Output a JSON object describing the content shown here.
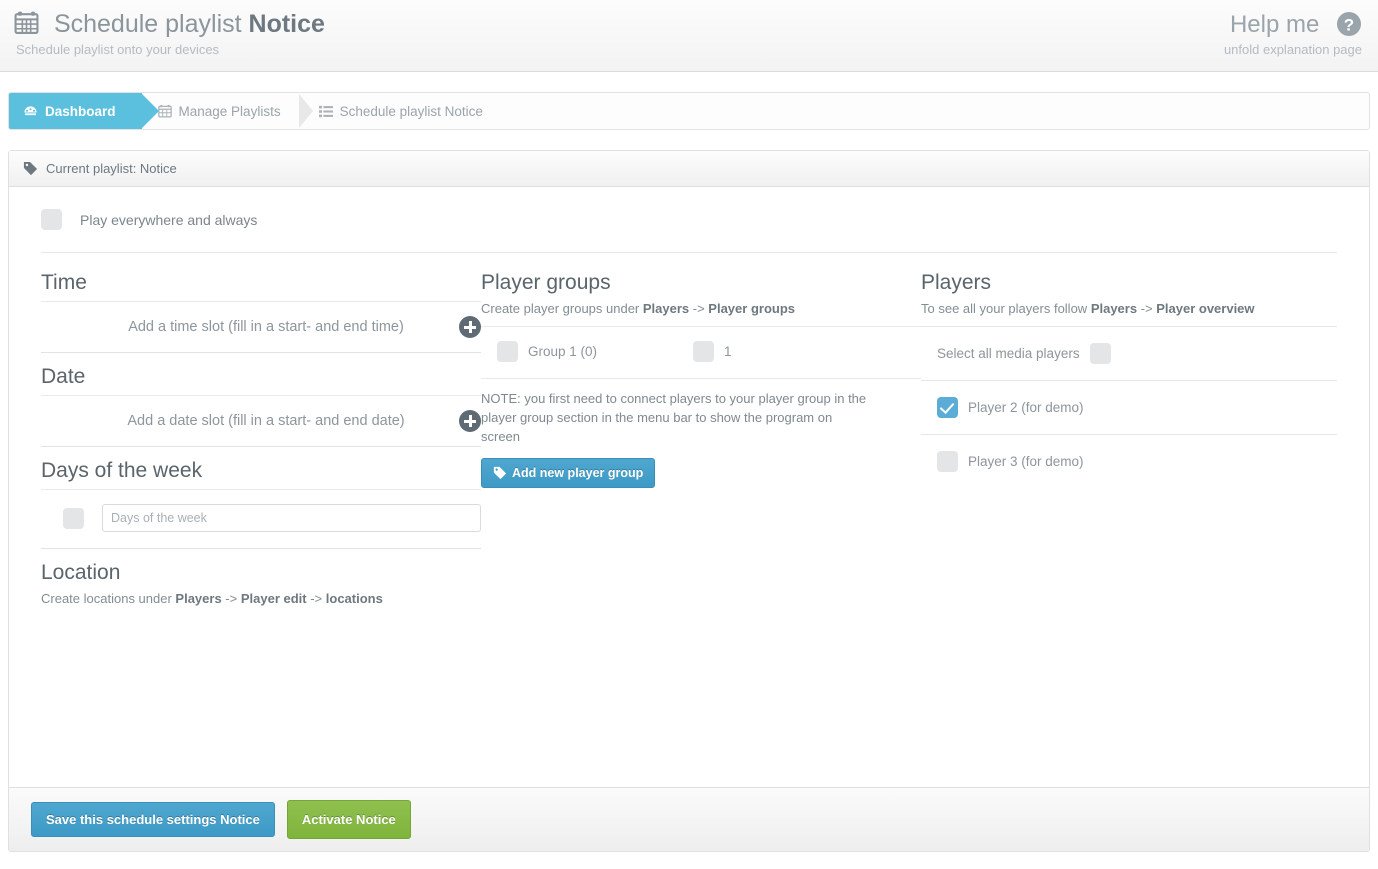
{
  "header": {
    "icon": "calendar-icon",
    "title_prefix": "Schedule playlist ",
    "title_strong": "Notice",
    "subtitle": "Schedule playlist onto your devices",
    "help_title": "Help me",
    "help_subtitle": "unfold explanation page",
    "help_icon": "question-circle-icon"
  },
  "breadcrumb": {
    "items": [
      {
        "label": "Dashboard",
        "icon": "dashboard-icon",
        "active": true
      },
      {
        "label": "Manage Playlists",
        "icon": "calendar-icon",
        "active": false
      },
      {
        "label": "Schedule playlist Notice",
        "icon": "list-icon",
        "active": false
      }
    ]
  },
  "panel": {
    "head_icon": "tag-icon",
    "head_title": "Current playlist: Notice",
    "play_everywhere_label": "Play everywhere and always",
    "play_everywhere_checked": false
  },
  "time_column": {
    "time_title": "Time",
    "time_slot_text": "Add a time slot (fill in a start- and end time)",
    "date_title": "Date",
    "date_slot_text": "Add a date slot (fill in a start- and end date)",
    "dow_title": "Days of the week",
    "dow_checked": false,
    "dow_placeholder": "Days of the week",
    "dow_value": "",
    "location_title": "Location",
    "location_hint_pre": "Create locations under ",
    "location_hint_b1": "Players",
    "location_hint_mid1": " -> ",
    "location_hint_b2": "Player edit",
    "location_hint_mid2": " -> ",
    "location_hint_b3": "locations"
  },
  "groups_column": {
    "title": "Player groups",
    "hint_pre": "Create player groups under ",
    "hint_b1": "Players",
    "hint_mid": " -> ",
    "hint_b2": "Player groups",
    "groups": [
      {
        "label": "Group 1 (0)",
        "checked": false
      },
      {
        "label": "1",
        "checked": false
      }
    ],
    "note": "NOTE: you first need to connect players to your player group in the player group section in the menu bar to show the program on screen",
    "add_button_label": "Add new player group",
    "add_button_icon": "tag-icon"
  },
  "players_column": {
    "title": "Players",
    "hint_pre": "To see all your players follow ",
    "hint_b1": "Players",
    "hint_mid": " -> ",
    "hint_b2": "Player overview",
    "select_all_label": "Select all media players",
    "select_all_checked": false,
    "players": [
      {
        "label": "Player 2 (for demo)",
        "checked": true
      },
      {
        "label": "Player 3 (for demo)",
        "checked": false
      }
    ]
  },
  "footer": {
    "save_label": "Save this schedule settings Notice",
    "activate_label": "Activate Notice"
  },
  "colors": {
    "accent_blue": "#5bc0de",
    "button_blue": "#3d9ac6",
    "button_green": "#7fb43c",
    "checkbox_checked": "#5bacd6",
    "checkbox_empty": "#e4e5e6",
    "plus_circle": "#5e6b75",
    "text_muted": "#8d969c"
  }
}
